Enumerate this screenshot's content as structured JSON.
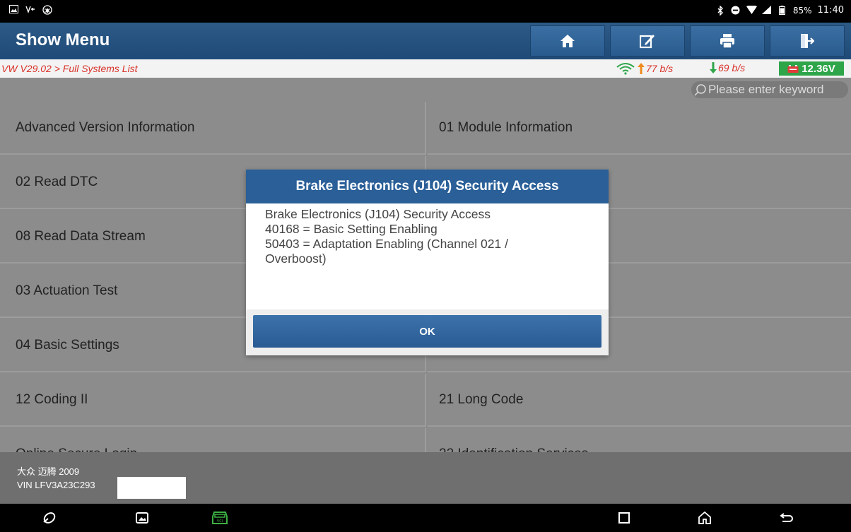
{
  "status_bar": {
    "battery": "85%",
    "time": "11:40"
  },
  "header": {
    "title": "Show Menu",
    "buttons": [
      "home-icon",
      "edit-note-icon",
      "print-icon",
      "exit-icon"
    ]
  },
  "breadcrumb": {
    "path": "VW V29.02 > Full Systems List",
    "upload_rate": "77 b/s",
    "download_rate": "69 b/s",
    "voltage": "12.36V"
  },
  "search": {
    "placeholder": "Please enter keyword"
  },
  "menu": {
    "items": [
      {
        "left": "Advanced Version Information",
        "right": "01 Module Information"
      },
      {
        "left": "02 Read DTC",
        "right": ""
      },
      {
        "left": "08 Read Data Stream",
        "right": ""
      },
      {
        "left": "03 Actuation Test",
        "right": ""
      },
      {
        "left": "04 Basic Settings",
        "right": ""
      },
      {
        "left": "12 Coding II",
        "right": "21 Long Code"
      },
      {
        "left": "Online Secure Login",
        "right": "22 Identification Services"
      }
    ]
  },
  "footer": {
    "vehicle": "大众 迈腾 2009",
    "vin": "VIN LFV3A23C293"
  },
  "dialog": {
    "title": "Brake Electronics (J104) Security Access",
    "lines": [
      "Brake Electronics (J104) Security Access",
      "40168 = Basic Setting Enabling",
      "50403 = Adaptation Enabling (Channel 021 /",
      "Overboost)"
    ],
    "ok_label": "OK"
  },
  "colors": {
    "header_blue": "#2d5a87",
    "breadcrumb_red": "#d9322a",
    "voltage_green": "#2fa54a",
    "vci_green": "#3cb043"
  }
}
